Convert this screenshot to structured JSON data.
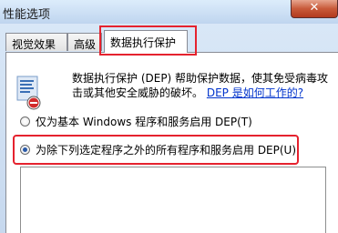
{
  "window": {
    "title": "性能选项",
    "close_symbol": "✕"
  },
  "tabs": [
    {
      "label": "视觉效果"
    },
    {
      "label": "高级"
    },
    {
      "label": "数据执行保护"
    }
  ],
  "dep": {
    "description": "数据执行保护 (DEP) 帮助保护数据，使其免受病毒攻击或其他安全威胁的破坏。",
    "link_text": "DEP 是如何工作的?",
    "options": [
      {
        "label": "仅为基本 Windows 程序和服务启用 DEP(T)",
        "checked": false
      },
      {
        "label": "为除下列选定程序之外的所有程序和服务启用 DEP(U)",
        "checked": true
      }
    ]
  },
  "colors": {
    "highlight": "#e5222e",
    "link": "#0033cc"
  }
}
